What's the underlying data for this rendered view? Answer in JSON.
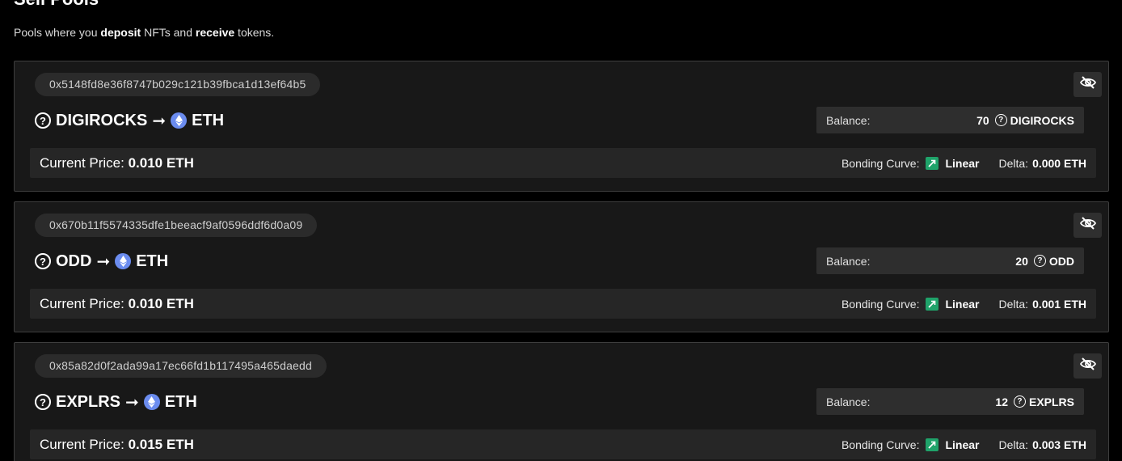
{
  "section": {
    "title": "Sell Pools",
    "sub_pre": "Pools where you ",
    "sub_b1": "deposit",
    "sub_mid": " NFTs and ",
    "sub_b2": "receive",
    "sub_post": " tokens."
  },
  "labels": {
    "balance": "Balance:",
    "current_price": "Current Price:",
    "bonding_curve": "Bonding Curve:",
    "delta": "Delta:",
    "arrow": "➞",
    "question": "?"
  },
  "icons": {
    "hide": "eye-off-icon",
    "unknown_token": "question-circle-icon",
    "eth": "eth-icon",
    "curve": "linear-trend-icon"
  },
  "colors": {
    "background": "#000000",
    "card": "#181818",
    "eth": "#6b8cef",
    "curve_badge": "#1fa36a"
  },
  "pools": [
    {
      "address": "0x5148fd8e36f8747b029c121b39fbca1d13ef64b5",
      "nft": "DIGIROCKS",
      "token": "ETH",
      "balance_amount": "70",
      "balance_token": "DIGIROCKS",
      "price": "0.010 ETH",
      "curve": "Linear",
      "delta": "0.000 ETH"
    },
    {
      "address": "0x670b11f5574335dfe1beeacf9af0596ddf6d0a09",
      "nft": "ODD",
      "token": "ETH",
      "balance_amount": "20",
      "balance_token": "ODD",
      "price": "0.010 ETH",
      "curve": "Linear",
      "delta": "0.001 ETH"
    },
    {
      "address": "0x85a82d0f2ada99a17ec66fd1b117495a465daedd",
      "nft": "EXPLRS",
      "token": "ETH",
      "balance_amount": "12",
      "balance_token": "EXPLRS",
      "price": "0.015 ETH",
      "curve": "Linear",
      "delta": "0.003 ETH"
    }
  ]
}
